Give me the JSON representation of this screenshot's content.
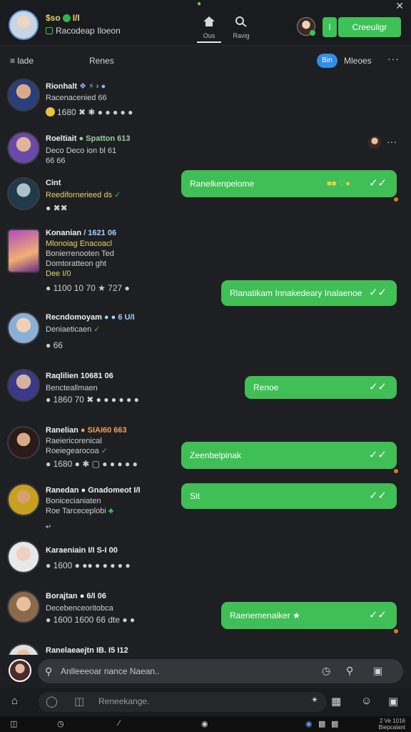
{
  "topbar": {
    "user_name": "$so",
    "user_name_suffix": "I/I",
    "user_status": "Racodeap Iloeon",
    "nav_home_label": "Ous",
    "nav_search_label": "Ravig",
    "small_button": "I",
    "cta_button": "Creeuligr"
  },
  "subbar": {
    "menu_label": "≡ lade",
    "center_label": "Renes",
    "pill_label": "Bin",
    "pill2_label": "Mleoes"
  },
  "feed": [
    {
      "name": "Rionhalt",
      "extra": "❖ ⚡ › ●",
      "lines": [
        "Racenacenied 66"
      ],
      "reacts": "1680  ✖  ✱  ● ● ●  ● ●"
    },
    {
      "name": "Roeltiait",
      "extra": "● Spatton 613",
      "lines": [
        "Deco  Deco ion bl 61",
        "           66  66"
      ]
    },
    {
      "name": "Cint",
      "lines": [
        "Reedifornerieed ds"
      ],
      "reacts": "●  ✖✖"
    },
    {
      "name": "Konanian",
      "extra": "/ 1621 06",
      "lines": [
        "Mlonoiag  Enacoacl",
        "Bonierrenooten Ted",
        "Domtoratteon ght",
        "Dee  I/0"
      ],
      "reacts": "●  1100  10  70  ★  727  ●"
    },
    {
      "name": "Recndomoyam",
      "extra": "● ● 6 U/I",
      "lines": [
        "Deniaeticaen"
      ],
      "reacts": "●  66"
    },
    {
      "name": "Raqlilien",
      "extra": "10681 06",
      "lines": [
        "Bencteallmaen"
      ],
      "reacts": "●  1860  70  ✖  ● ● ● ●  ● ●"
    },
    {
      "name": "Ranelian",
      "extra": "● SIAI60 663",
      "lines": [
        "Raeiericorenical",
        "Roeiegearocoa"
      ],
      "reacts": "●  1680  ●  ✱  ▢  ● ● ●  ● ●"
    },
    {
      "name": "Ranedan",
      "extra": "● Gnadomeot I/I",
      "lines": [
        "Bonicecianiaten",
        "Roe Tarceceplobi"
      ],
      "reacts": "↵"
    },
    {
      "name": "Karaeniain",
      "extra": "I/I S-I 00",
      "lines": [],
      "reacts": "● 1600  ●  ●●  ● ● ●  ● ●"
    },
    {
      "name": "Borajtan",
      "extra": "● 6/I 06",
      "lines": [
        "Decebenceoritobca"
      ],
      "reacts": "●  1600  1600 66  dte  ● ●"
    },
    {
      "name": "Ranelaeaejtn",
      "extra": "IB. I5 I12",
      "lines": [],
      "reacts": ""
    }
  ],
  "bubbles": [
    {
      "text": "Ranelkenpelome",
      "ticks": "✓✓",
      "extra": "■■  ♡●"
    },
    {
      "text": "Rlanatikam  Innakedeary  Inalaenoe",
      "ticks": "✓✓"
    },
    {
      "text": "Renoe",
      "ticks": "✓✓"
    },
    {
      "text": "Zeenbelpinak",
      "ticks": "✓✓"
    },
    {
      "text": "Sit",
      "ticks": "✓✓"
    },
    {
      "text": "Raenemenaiker  ★",
      "ticks": "✓✓"
    }
  ],
  "composer": {
    "placeholder": "Anlleeeoar nance Naean.."
  },
  "actionbar": {
    "placeholder": "Reneekange."
  },
  "sysbar": {
    "label1": "2 Ve 1016",
    "label2": "Biepcalant"
  },
  "colors": {
    "bubble_green": "#3fbf55",
    "cta_green": "#3cc257",
    "pill_blue": "#2f8fe8",
    "background": "#1e1f22"
  }
}
